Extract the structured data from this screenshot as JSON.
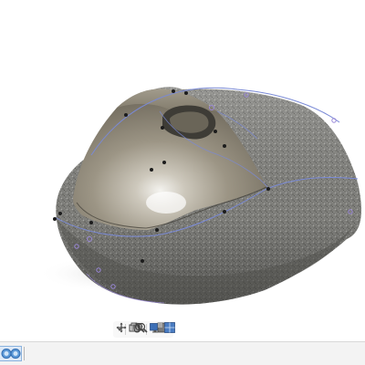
{
  "viewport": {
    "background": "#ffffff",
    "model": "mouse-body-3d-mesh",
    "surface_colors": {
      "mesh": "#8e8e8a",
      "mesh_shadow": "#5c5c58",
      "smooth_body": "#a39d8c",
      "highlight": "#f2f2ef",
      "guide_curve": "#7a8ad6",
      "control_point": "#1c1c1c",
      "handle_point": "#9a88d8",
      "floor_shadow": "#d8d8d8"
    }
  },
  "nav_toolbar": {
    "buttons": [
      {
        "name": "orbit-icon",
        "has_menu": true
      },
      {
        "name": "look-at-icon",
        "has_menu": false
      },
      {
        "name": "pan-hand-icon",
        "has_menu": false
      },
      {
        "name": "zoom-icon",
        "has_menu": false
      },
      {
        "name": "fit-zoom-icon",
        "has_menu": true
      },
      {
        "name": "display-settings-icon",
        "has_menu": true
      },
      {
        "name": "visual-style-icon",
        "has_menu": true
      },
      {
        "name": "grid-layout-icon",
        "has_menu": true
      }
    ]
  },
  "timeline": {
    "items": [
      {
        "name": "form-feature-icon",
        "state": "active"
      }
    ],
    "accent": "#8cb3de"
  }
}
